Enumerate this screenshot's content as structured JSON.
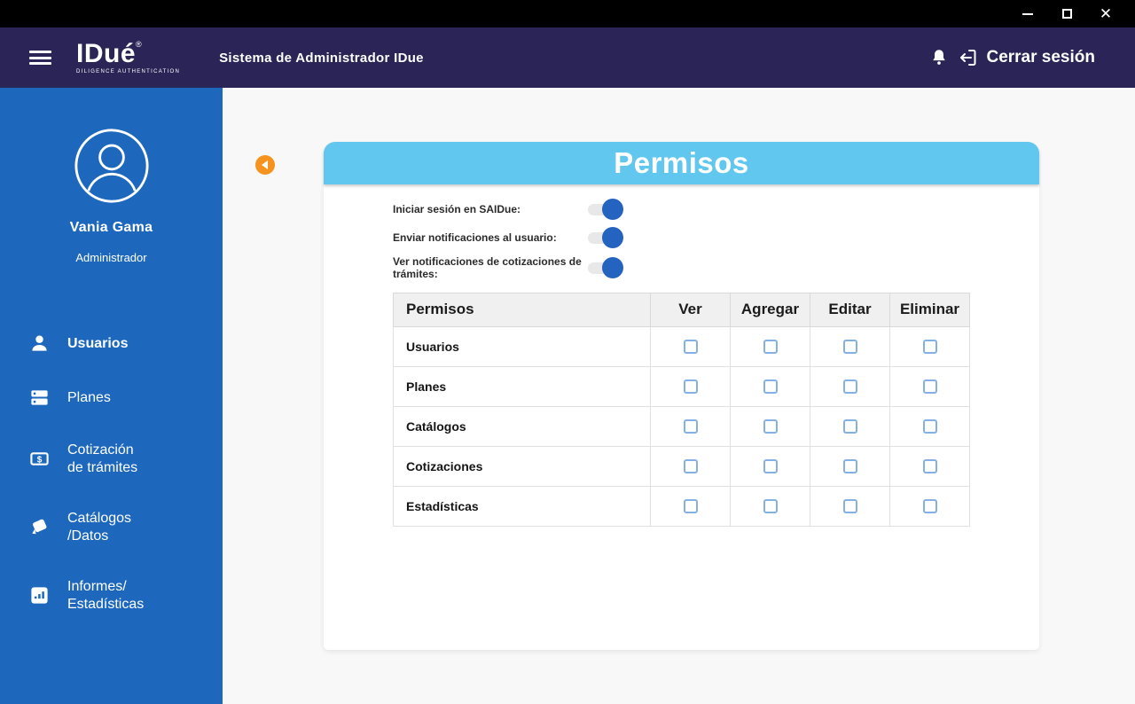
{
  "window": {
    "close_glyph": "✕"
  },
  "header": {
    "app_name": "IDué",
    "registered_mark": "®",
    "tagline": "DILIGENCE AUTHENTICATION",
    "subtitle": "Sistema de Administrador IDue",
    "logout_label": "Cerrar sesión"
  },
  "sidebar": {
    "user_name": "Vania Gama",
    "user_role": "Administrador",
    "items": [
      {
        "lines": [
          "Usuarios"
        ],
        "active": true
      },
      {
        "lines": [
          "Planes"
        ],
        "active": false
      },
      {
        "lines": [
          "Cotización",
          "de trámites"
        ],
        "active": false
      },
      {
        "lines": [
          "Catálogos",
          "/Datos"
        ],
        "active": false
      },
      {
        "lines": [
          "Informes/",
          "Estadísticas"
        ],
        "active": false
      }
    ]
  },
  "main": {
    "panel_title": "Permisos",
    "toggles": [
      {
        "label": "Iniciar sesión en SAIDue:",
        "state": "on"
      },
      {
        "label": "Enviar notificaciones al usuario:",
        "state": "on"
      },
      {
        "label": "Ver notificaciones de cotizaciones de trámites:",
        "state": "on"
      }
    ],
    "table": {
      "headers": [
        "Permisos",
        "Ver",
        "Agregar",
        "Editar",
        "Eliminar"
      ],
      "rows": [
        {
          "label": "Usuarios",
          "checks": [
            false,
            false,
            false,
            false
          ]
        },
        {
          "label": "Planes",
          "checks": [
            false,
            false,
            false,
            false
          ]
        },
        {
          "label": "Catálogos",
          "checks": [
            false,
            false,
            false,
            false
          ]
        },
        {
          "label": "Cotizaciones",
          "checks": [
            false,
            false,
            false,
            false
          ]
        },
        {
          "label": "Estadísticas",
          "checks": [
            false,
            false,
            false,
            false
          ]
        }
      ]
    }
  },
  "colors": {
    "titlebar": "#000000",
    "appbar": "#2a2457",
    "sidebar": "#1d68bd",
    "panel_header": "#62c7ee",
    "accent_orange": "#f6921e",
    "toggle_on": "#2463c0",
    "toggle_track": "#e8e8e8",
    "checkbox_border": "#85b0e3"
  }
}
